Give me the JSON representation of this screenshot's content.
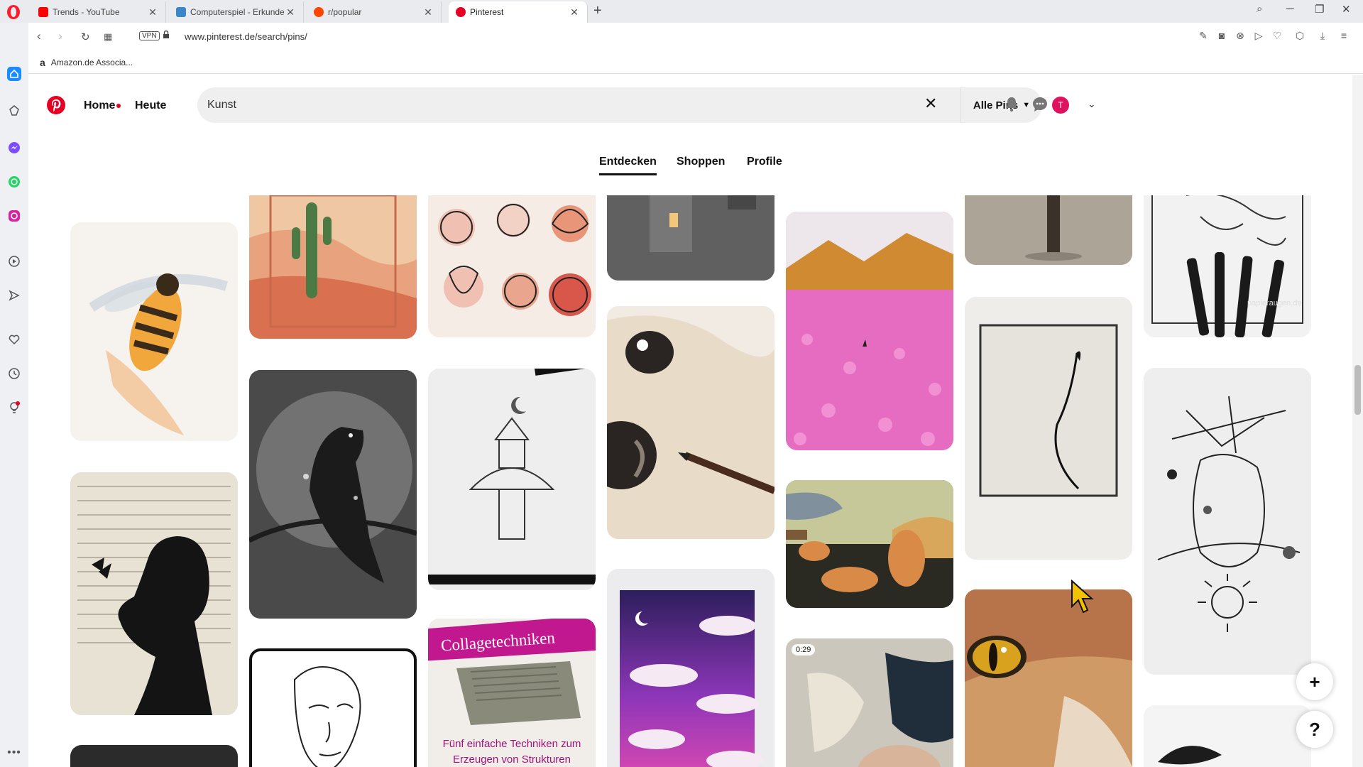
{
  "browser": {
    "tabs": [
      {
        "title": "Trends - YouTube",
        "favicon_color": "#ff0000"
      },
      {
        "title": "Computerspiel - Erkunden",
        "favicon_color": "#3a86c8"
      },
      {
        "title": "r/popular",
        "favicon_color": "#ff4500"
      },
      {
        "title": "Pinterest",
        "favicon_color": "#e60023"
      }
    ],
    "vpn_label": "VPN",
    "url": "www.pinterest.de/search/pins/",
    "bookmark": {
      "icon": "a",
      "label": "Amazon.de Associa..."
    }
  },
  "pinterest": {
    "nav": {
      "home": "Home",
      "today": "Heute"
    },
    "search": {
      "value": "Kunst"
    },
    "filter_label": "Alle Pins",
    "avatar_initial": "T",
    "tabs": {
      "discover": "Entdecken",
      "shop": "Shoppen",
      "profiles": "Profile"
    },
    "pins": {
      "collage_title": "Collagetechniken",
      "collage_caption": "Fünf einfache Techniken zum Erzeugen von Strukturen",
      "video_duration": "0:29",
      "watermark": "papieraugen.de"
    },
    "fab_add": "+",
    "fab_help": "?"
  },
  "colors": {
    "brand": "#e60023"
  }
}
